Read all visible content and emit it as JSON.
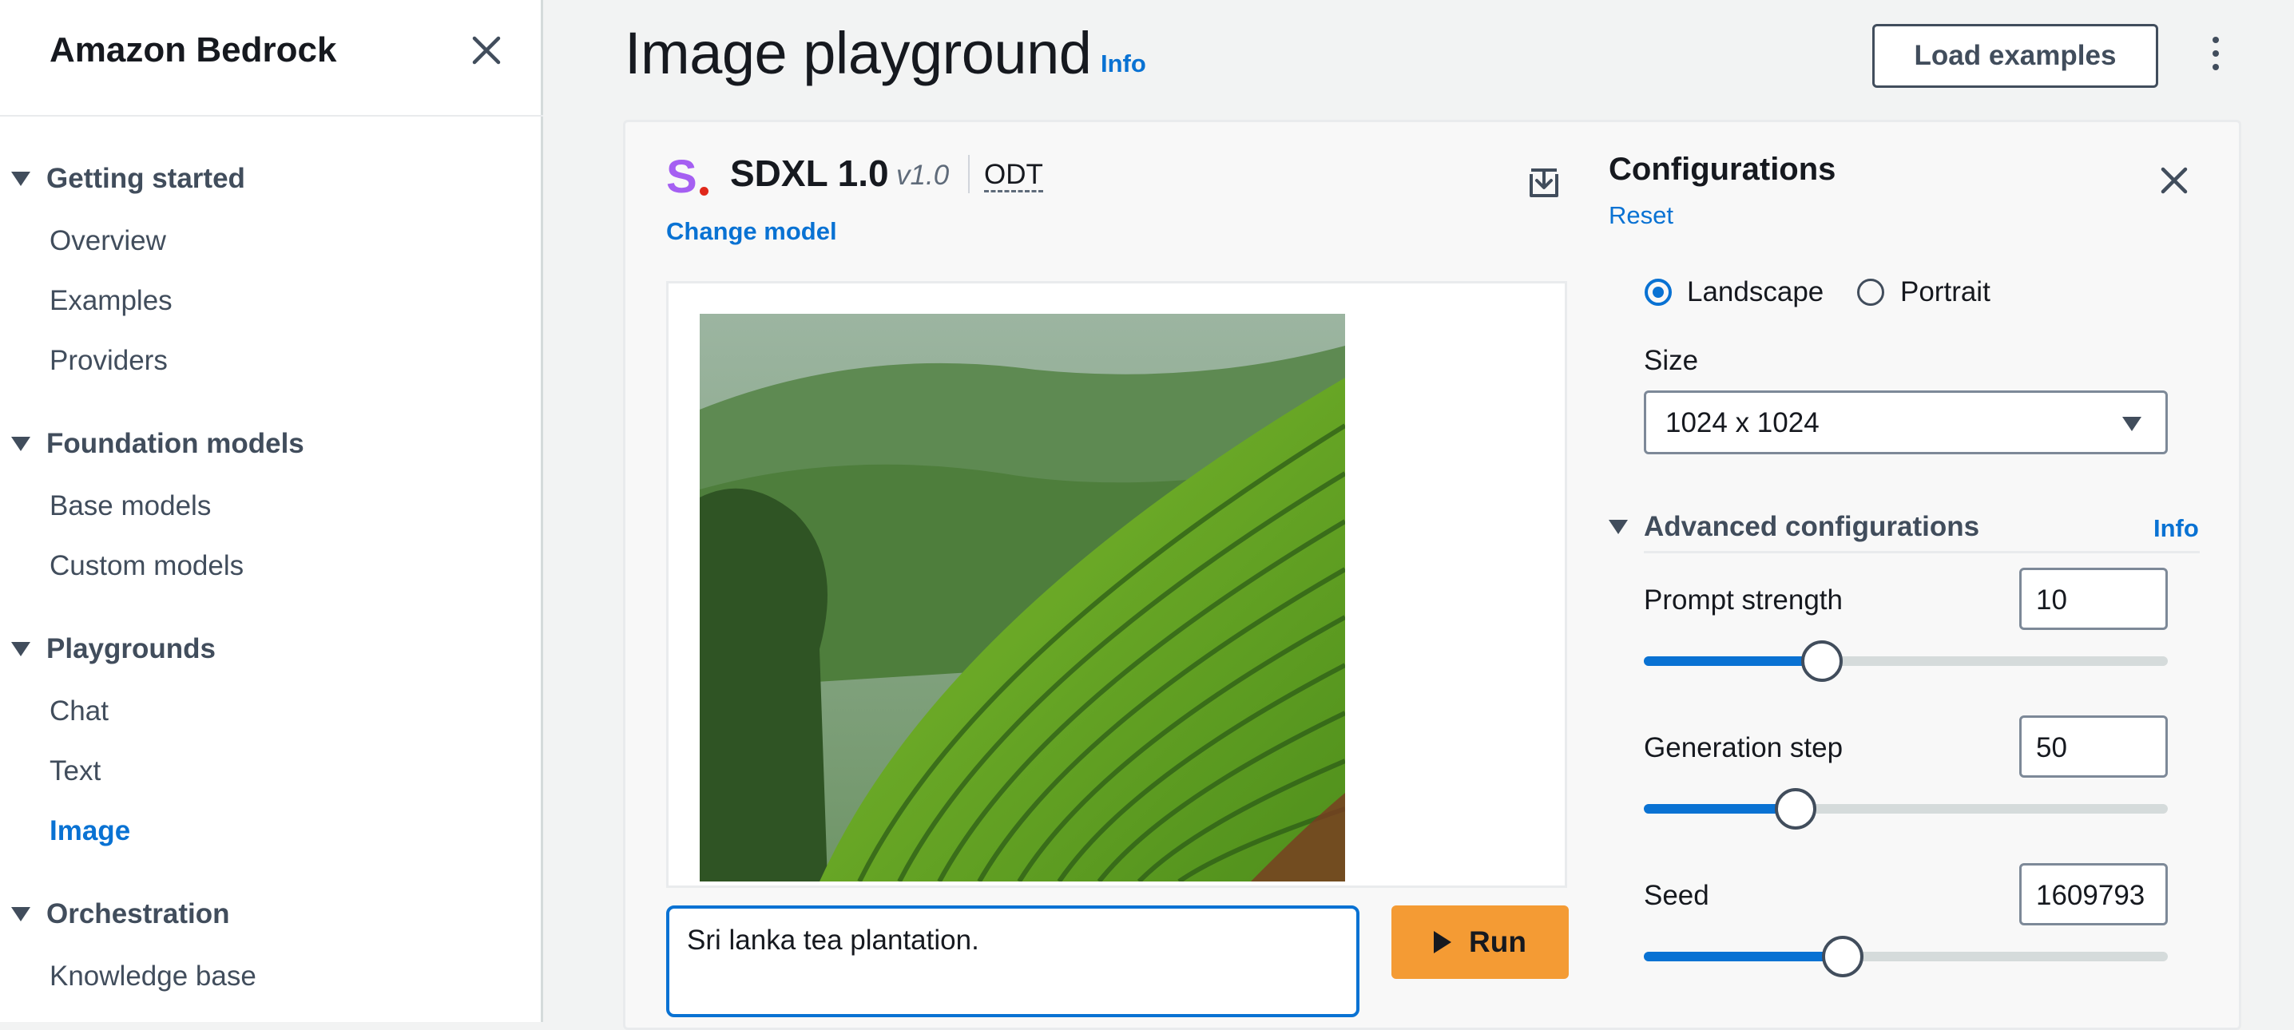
{
  "sidebar": {
    "title": "Amazon Bedrock",
    "sections": [
      {
        "label": "Getting started",
        "items": [
          "Overview",
          "Examples",
          "Providers"
        ]
      },
      {
        "label": "Foundation models",
        "items": [
          "Base models",
          "Custom models"
        ]
      },
      {
        "label": "Playgrounds",
        "items": [
          "Chat",
          "Text",
          "Image"
        ]
      },
      {
        "label": "Orchestration",
        "items": [
          "Knowledge base"
        ]
      }
    ],
    "active_item": "Image"
  },
  "header": {
    "title": "Image playground",
    "info": "Info",
    "load_examples": "Load examples"
  },
  "model": {
    "logo_letter": "S",
    "name": "SDXL 1.0",
    "version": "v1.0",
    "tag": "ODT",
    "change_model": "Change model"
  },
  "prompt": {
    "text": "Sri lanka tea plantation.",
    "run_label": "Run"
  },
  "config": {
    "title": "Configurations",
    "reset": "Reset",
    "orientation": {
      "options": [
        "Landscape",
        "Portrait"
      ],
      "selected": "Landscape"
    },
    "size_label": "Size",
    "size_value": "1024 x 1024",
    "advanced_label": "Advanced configurations",
    "advanced_info": "Info",
    "prompt_strength": {
      "label": "Prompt strength",
      "value": "10",
      "level": 0.34
    },
    "generation_step": {
      "label": "Generation step",
      "value": "50",
      "level": 0.29
    },
    "seed": {
      "label": "Seed",
      "value": "1609793",
      "level": 0.38
    }
  },
  "colors": {
    "accent": "#0972d3",
    "run_button": "#f49b34",
    "logo_purple": "#a55ff2",
    "logo_dot": "#e0281b"
  }
}
